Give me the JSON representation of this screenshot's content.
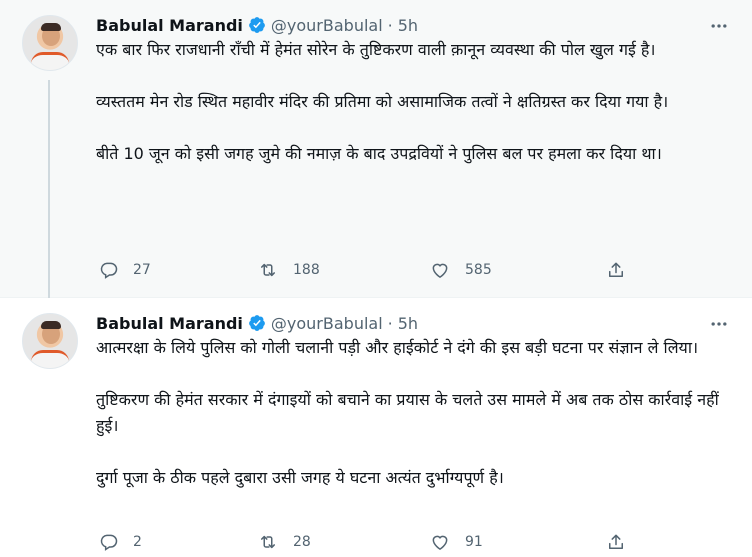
{
  "tweets": [
    {
      "author": {
        "name": "Babulal Marandi",
        "handle": "@yourBabulal",
        "time": "5h"
      },
      "paragraphs": [
        "एक बार फिर राजधानी राँची में हेमंत सोरेन के तुष्टिकरण वाली क़ानून व्यवस्था की पोल खुल गई है।",
        "व्यस्ततम मेन रोड स्थित महावीर मंदिर की प्रतिमा को असामाजिक तत्वों ने क्षतिग्रस्त कर दिया गया है।",
        "बीते 10 जून को इसी जगह जुमे की नमाज़ के बाद उपद्रवियों ने पुलिस बल पर हमला कर दिया था।"
      ],
      "metrics": {
        "replies": "27",
        "retweets": "188",
        "likes": "585"
      }
    },
    {
      "author": {
        "name": "Babulal Marandi",
        "handle": "@yourBabulal",
        "time": "5h"
      },
      "paragraphs": [
        "आत्मरक्षा के लिये पुलिस को गोली चलानी पड़ी और हाईकोर्ट ने दंगे की इस बड़ी घटना पर संज्ञान ले लिया।",
        "तुष्टिकरण की हेमंत सरकार में दंगाइयों को बचाने का प्रयास के चलते उस मामले में अब तक ठोस कार्रवाई नहीं हुई।",
        "दुर्गा पूजा के ठीक पहले दुबारा उसी जगह ये घटना अत्यंत दुर्भाग्यपूर्ण है।"
      ],
      "metrics": {
        "replies": "2",
        "retweets": "28",
        "likes": "91"
      }
    }
  ],
  "separator": "·",
  "colors": {
    "verified": "#1d9bf0",
    "muted": "#536471",
    "thread_line": "#cfd9de"
  },
  "icons": [
    "verified-badge-icon",
    "more-icon",
    "reply-icon",
    "retweet-icon",
    "like-icon",
    "share-icon"
  ]
}
